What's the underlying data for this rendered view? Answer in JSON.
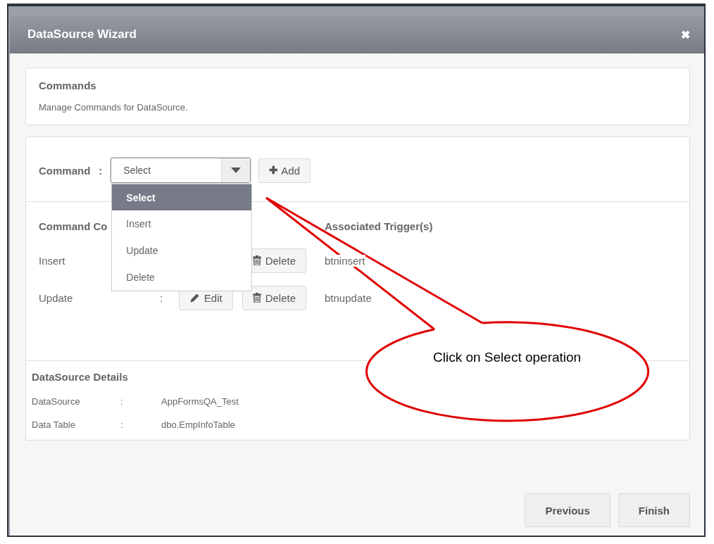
{
  "window": {
    "title": "DataSource Wizard",
    "close": "✖"
  },
  "intro": {
    "title": "Commands",
    "description": "Manage Commands for DataSource."
  },
  "command_picker": {
    "label": "Command",
    "separator": ":",
    "value": "Select",
    "add_button": {
      "icon": "✚",
      "label": "Add"
    },
    "dropdown": {
      "expanded": true,
      "options": [
        {
          "label": "Select",
          "selected": true
        },
        {
          "label": "Insert",
          "selected": false
        },
        {
          "label": "Update",
          "selected": false
        },
        {
          "label": "Delete",
          "selected": false
        }
      ]
    }
  },
  "commands_table": {
    "column_1": "Command Co",
    "trigger_heading": "Associated Trigger(s)",
    "rows": [
      {
        "label": "Insert",
        "buttons": [
          {
            "kind": "delete",
            "label": "Delete"
          }
        ],
        "trigger": "btninsert"
      },
      {
        "label": "Update",
        "separator": ":",
        "buttons": [
          {
            "kind": "edit",
            "label": "Edit"
          },
          {
            "kind": "delete",
            "label": "Delete"
          }
        ],
        "trigger": "btnupdate"
      }
    ]
  },
  "details": {
    "title": "DataSource Details",
    "rows": [
      {
        "label": "DataSource",
        "separator": ":",
        "value": "AppFormsQA_Test"
      },
      {
        "label": "Data Table",
        "separator": ":",
        "value": "dbo.EmpInfoTable"
      }
    ]
  },
  "footer": {
    "buttons": [
      "Previous",
      "Finish"
    ]
  },
  "callout": {
    "text": "Click on Select operation"
  }
}
